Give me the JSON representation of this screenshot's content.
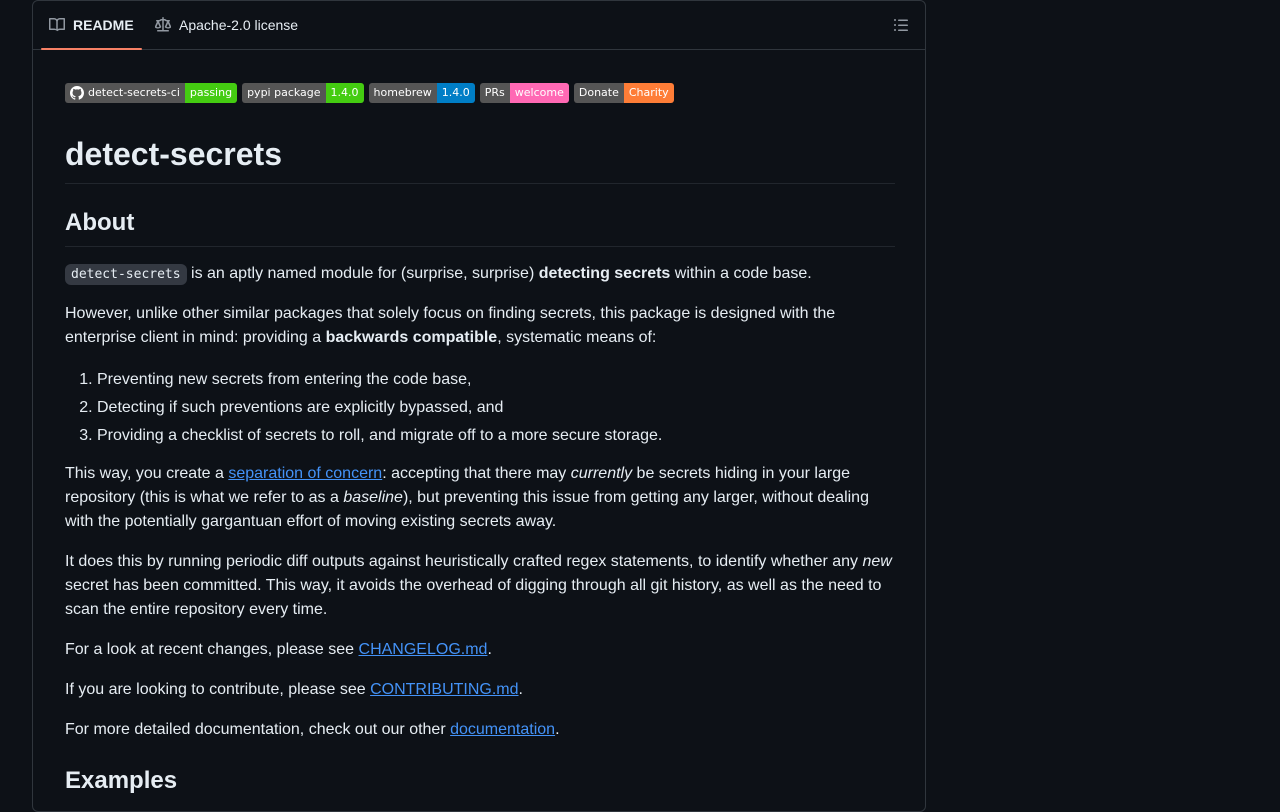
{
  "tabs": {
    "readme": "README",
    "license": "Apache-2.0 license"
  },
  "badges": [
    {
      "label": "detect-secrets-ci",
      "value": "passing",
      "color": "#4c1"
    },
    {
      "label": "pypi package",
      "value": "1.4.0",
      "color": "#4c1"
    },
    {
      "label": "homebrew",
      "value": "1.4.0",
      "color": "#007ec6"
    },
    {
      "label": "PRs",
      "value": "welcome",
      "color": "#ff69b4"
    },
    {
      "label": "Donate",
      "value": "Charity",
      "color": "#fe7d37"
    }
  ],
  "title": "detect-secrets",
  "about": {
    "heading": "About",
    "p1": {
      "code": "detect-secrets",
      "t1": " is an aptly named module for (surprise, surprise) ",
      "b1": "detecting secrets",
      "t2": " within a code base."
    },
    "p2": {
      "t1": "However, unlike other similar packages that solely focus on finding secrets, this package is designed with the enterprise client in mind: providing a ",
      "b1": "backwards compatible",
      "t2": ", systematic means of:"
    },
    "list": [
      "Preventing new secrets from entering the code base,",
      "Detecting if such preventions are explicitly bypassed, and",
      "Providing a checklist of secrets to roll, and migrate off to a more secure storage."
    ],
    "p3": {
      "t1": "This way, you create a ",
      "link": "separation of concern",
      "t2": ": accepting that there may ",
      "i1": "currently",
      "t3": " be secrets hiding in your large repository (this is what we refer to as a ",
      "i2": "baseline",
      "t4": "), but preventing this issue from getting any larger, without dealing with the potentially gargantuan effort of moving existing secrets away."
    },
    "p4": {
      "t1": "It does this by running periodic diff outputs against heuristically crafted regex statements, to identify whether any ",
      "i1": "new",
      "t2": " secret has been committed. This way, it avoids the overhead of digging through all git history, as well as the need to scan the entire repository every time."
    },
    "p5": {
      "t1": "For a look at recent changes, please see ",
      "link": "CHANGELOG.md",
      "t2": "."
    },
    "p6": {
      "t1": "If you are looking to contribute, please see ",
      "link": "CONTRIBUTING.md",
      "t2": "."
    },
    "p7": {
      "t1": "For more detailed documentation, check out our other ",
      "link": "documentation",
      "t2": "."
    }
  },
  "examples_heading": "Examples",
  "icons": {
    "readme": "book-icon",
    "license": "law-scale-icon",
    "toc": "list-unordered-icon",
    "github": "github-mark-icon"
  }
}
